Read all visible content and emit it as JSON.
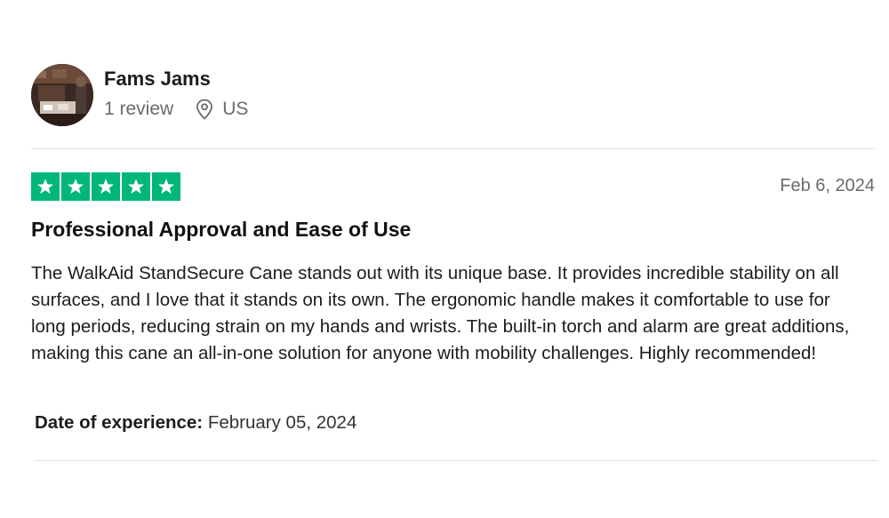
{
  "reviewer": {
    "name": "Fams Jams",
    "review_count": "1 review",
    "country": "US",
    "avatar_icon": "reviewer-photo",
    "location_icon": "map-pin-icon"
  },
  "review": {
    "rating": 5,
    "max_rating": 5,
    "star_color": "#00b67a",
    "date": "Feb 6, 2024",
    "title": "Professional Approval and Ease of Use",
    "body": "The WalkAid StandSecure Cane stands out with its unique base. It provides incredible stability on all surfaces, and I love that it stands on its own. The ergonomic handle makes it comfortable to use for long periods, reducing strain on my hands and wrists. The built-in torch and alarm are great additions, making this cane an all-in-one solution for anyone with mobility challenges. Highly recommended!",
    "experience_label": "Date of experience:",
    "experience_date": "February 05, 2024"
  }
}
